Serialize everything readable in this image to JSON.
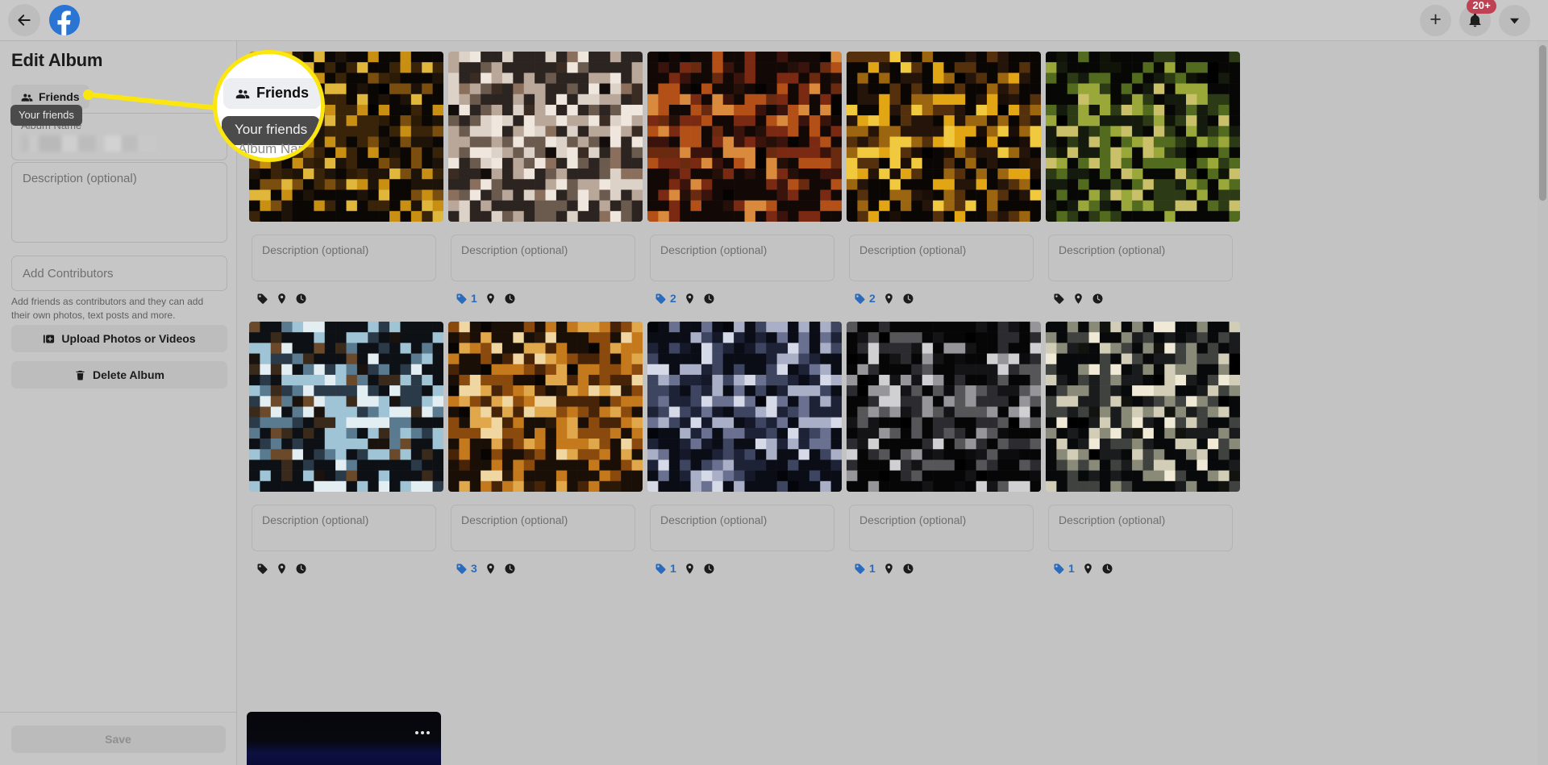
{
  "topbar": {
    "back_label": "Back",
    "logo_label": "Facebook",
    "create_label": "Create",
    "notifications_label": "Notifications",
    "notifications_badge": "20+",
    "account_label": "Account"
  },
  "sidebar": {
    "title": "Edit Album",
    "privacy": {
      "label": "Friends",
      "icon": "friends-icon",
      "tooltip": "Your friends"
    },
    "album_name": {
      "label": "Album Name",
      "value": ""
    },
    "description": {
      "placeholder": "Description (optional)",
      "value": ""
    },
    "contributors": {
      "placeholder": "Add Contributors",
      "value": "",
      "help": "Add friends as contributors and they can add their own photos, text posts and more."
    },
    "upload_button": {
      "label": "Upload Photos or Videos",
      "icon": "photo-add-icon"
    },
    "delete_button": {
      "label": "Delete Album",
      "icon": "trash-icon"
    },
    "save_button": {
      "label": "Save",
      "enabled": false
    }
  },
  "magnifier": {
    "chip_label": "Friends",
    "tooltip_label": "Your friends",
    "ghost_label": "Album Name",
    "ring_color": "#fbe60f"
  },
  "grid": {
    "description_placeholder": "Description (optional)",
    "icons": {
      "tag": "tag-icon",
      "location": "location-pin-icon",
      "time": "clock-icon"
    },
    "photos": [
      {
        "id": "photo-1",
        "tag_count": "",
        "palette": "warm-dark",
        "seed": 11
      },
      {
        "id": "photo-2",
        "tag_count": "1",
        "palette": "pale-warm",
        "seed": 23
      },
      {
        "id": "photo-3",
        "tag_count": "2",
        "palette": "red-warm",
        "seed": 37
      },
      {
        "id": "photo-4",
        "tag_count": "2",
        "palette": "amber-dark",
        "seed": 51
      },
      {
        "id": "photo-5",
        "tag_count": "",
        "palette": "olive-dark",
        "seed": 67
      },
      {
        "id": "photo-6",
        "tag_count": "",
        "palette": "teal-warm",
        "seed": 83
      },
      {
        "id": "photo-7",
        "tag_count": "3",
        "palette": "orange-mid",
        "seed": 97
      },
      {
        "id": "photo-8",
        "tag_count": "1",
        "palette": "blue-grey",
        "seed": 113
      },
      {
        "id": "photo-9",
        "tag_count": "1",
        "palette": "night-grey",
        "seed": 131
      },
      {
        "id": "photo-10",
        "tag_count": "1",
        "palette": "cream-dark",
        "seed": 149
      }
    ],
    "partial_row_photo": {
      "id": "photo-11",
      "menu_label": "More options"
    }
  }
}
